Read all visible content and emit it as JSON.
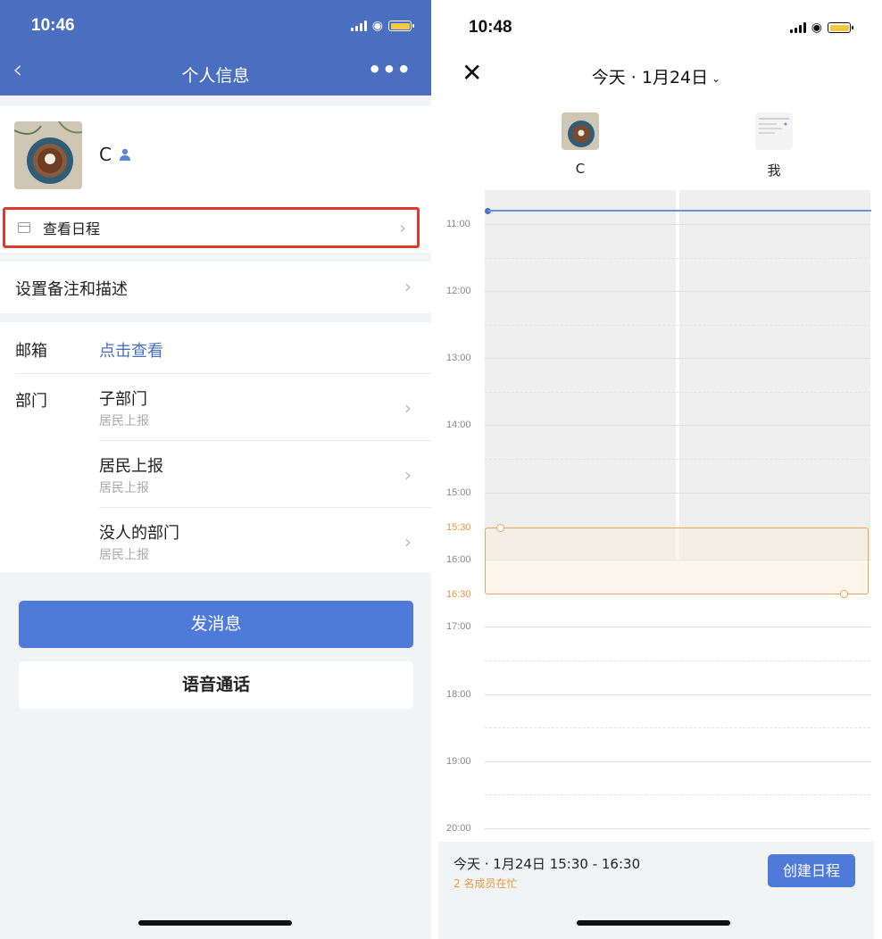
{
  "left": {
    "status_time": "10:46",
    "nav_title": "个人信息",
    "back_icon": "chevron-left-icon",
    "more_icon": "more-icon",
    "profile": {
      "name": "C"
    },
    "schedule_label": "查看日程",
    "note_label": "设置备注和描述",
    "email": {
      "label": "邮箱",
      "value": "点击查看"
    },
    "department": {
      "label": "部门",
      "items": [
        {
          "name": "子部门",
          "sub": "居民上报"
        },
        {
          "name": "居民上报",
          "sub": "居民上报"
        },
        {
          "name": "没人的部门",
          "sub": "居民上报"
        }
      ]
    },
    "send_message": "发消息",
    "voice_call": "语音通话"
  },
  "right": {
    "status_time": "10:48",
    "title": "今天 · 1月24日",
    "participants": [
      {
        "name": "C"
      },
      {
        "name": "我"
      }
    ],
    "hour_labels": [
      "11:00",
      "12:00",
      "13:00",
      "14:00",
      "15:00",
      "16:00",
      "17:00",
      "18:00",
      "19:00",
      "20:00"
    ],
    "selection": {
      "start_label": "15:30",
      "end_label": "16:30"
    },
    "footer": {
      "time_range": "今天 · 1月24日 15:30 - 16:30",
      "busy_note": "2 名成员在忙",
      "create_button": "创建日程"
    }
  },
  "colors": {
    "brand_blue": "#4a6fc0",
    "button_blue": "#4f7ad9",
    "highlight_red": "#e03a2f",
    "selection_orange": "#e8a45a"
  }
}
